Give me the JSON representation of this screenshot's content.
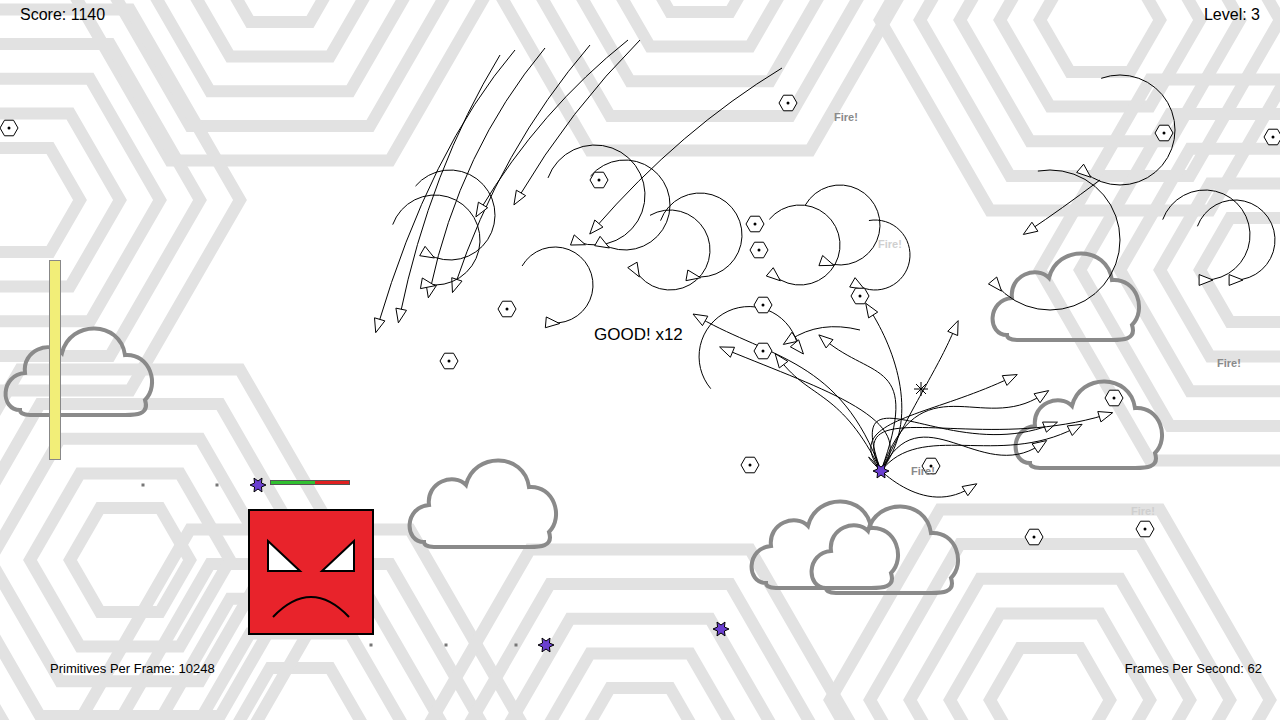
{
  "hud": {
    "score": "Score: 1140",
    "level": "Level: 3",
    "primitives": "Primitives Per Frame: 10248",
    "fps": "Frames Per Second: 62"
  },
  "combo": "GOOD! x12",
  "popups": [
    {
      "text": "Fire!",
      "faded": false
    },
    {
      "text": "Fire!",
      "faded": true
    },
    {
      "text": "Fire!",
      "faded": false
    },
    {
      "text": "Fire!",
      "faded": false
    },
    {
      "text": "Fire!",
      "faded": true
    }
  ],
  "enemy": {
    "health": 0.56
  },
  "power_bar": {
    "level": 1
  }
}
